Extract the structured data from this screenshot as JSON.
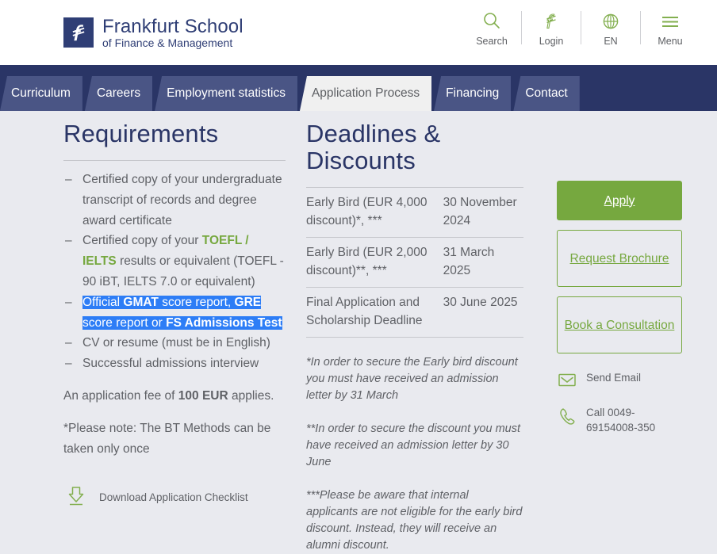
{
  "header": {
    "logo": {
      "mark_icon": "frankfurt-school-f-logo",
      "title": "Frankfurt School",
      "subtitle": "of Finance & Management"
    },
    "tools": [
      {
        "icon": "search-icon",
        "label": "Search"
      },
      {
        "icon": "login-icon",
        "label": "Login"
      },
      {
        "icon": "globe-icon",
        "label": "EN"
      },
      {
        "icon": "hamburger-menu-icon",
        "label": "Menu"
      }
    ]
  },
  "nav": {
    "tabs": [
      {
        "label": "Curriculum",
        "active": false
      },
      {
        "label": "Careers",
        "active": false
      },
      {
        "label": "Employment statistics",
        "active": false
      },
      {
        "label": "Application Process",
        "active": true
      },
      {
        "label": "Financing",
        "active": false
      },
      {
        "label": "Contact",
        "active": false
      }
    ]
  },
  "requirements": {
    "title": "Requirements",
    "items": [
      {
        "id": "transcript",
        "text_html": "Certified copy of your undergraduate transcript of records and degree award certificate"
      },
      {
        "id": "language",
        "text_html": "Certified copy of your <span class=\"green-b\" data-name=\"toefl-ielts-emphasis\">TOEFL / IELTS</span> results or equivalent (TOEFL - 90 iBT, IELTS 7.0 or equivalent)"
      },
      {
        "id": "test-score",
        "text_html": "<span class=\"hl\" data-name=\"selected-text-highlight\">Official <b>GMAT</b> score report, <b>GRE</b> score report or <b>FS Admissions Test</b></span>"
      },
      {
        "id": "cv",
        "text_html": "CV or resume (must be in English)"
      },
      {
        "id": "interview",
        "text_html": "Successful admissions interview"
      }
    ],
    "fee_text_html": "An application fee of <b>100 EUR</b> applies.",
    "note_text": "*Please note: The BT Methods can be taken only once",
    "download": {
      "icon": "download-arrow-icon",
      "label": "Download Application Checklist"
    }
  },
  "deadlines": {
    "title": "Deadlines & Discounts",
    "rows": [
      {
        "label": "Early Bird (EUR 4,000 discount)*, ***",
        "date": "30 November 2024"
      },
      {
        "label": "Early Bird (EUR 2,000 discount)**, ***",
        "date": "31 March 2025"
      },
      {
        "label": "Final Application and Scholarship Deadline",
        "date": "30 June 2025"
      }
    ],
    "notes": [
      "*In order to secure the Early bird discount you must have received an admission letter by 31 March",
      "**In order to secure the discount you must have received an admission letter by 30 June",
      "***Please be aware that internal applicants are not eligible for the early bird discount. Instead, they will receive an alumni discount."
    ]
  },
  "sidebar": {
    "buttons": [
      {
        "id": "apply",
        "label": "Apply",
        "style": "primary"
      },
      {
        "id": "request-brochure",
        "label": "Request Brochure",
        "style": "outline"
      },
      {
        "id": "book-consultation",
        "label": "Book a Consultation",
        "style": "outline"
      }
    ],
    "contacts": [
      {
        "id": "email",
        "icon": "envelope-icon",
        "text": "Send Email"
      },
      {
        "id": "phone",
        "icon": "phone-icon",
        "text": "Call 0049-69154008-350"
      }
    ]
  },
  "colors": {
    "navy": "#2a3566",
    "tab_blue": "#4a5585",
    "green": "#76a83f",
    "page_bg": "#e9eaef",
    "selection_blue": "#2d7df6",
    "body_text": "#5f6166"
  }
}
